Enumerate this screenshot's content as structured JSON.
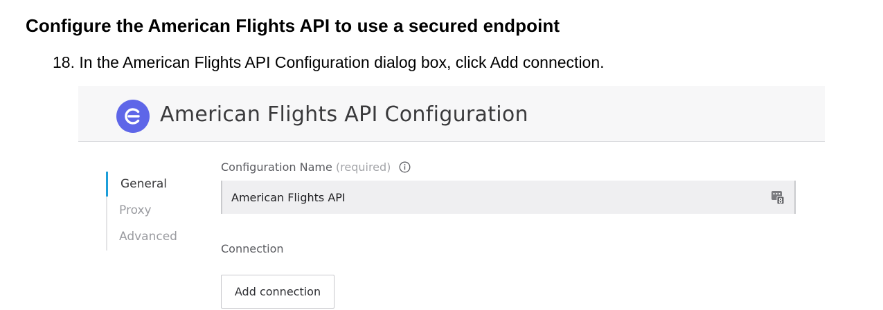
{
  "document": {
    "heading": "Configure the American Flights API to use a secured endpoint",
    "step": "18. In the American Flights API Configuration dialog box, click Add connection."
  },
  "dialog": {
    "title": "American Flights API Configuration",
    "nav": {
      "items": [
        {
          "label": "General",
          "active": true
        },
        {
          "label": "Proxy",
          "active": false
        },
        {
          "label": "Advanced",
          "active": false
        }
      ]
    },
    "config_name": {
      "label": "Configuration Name",
      "required": "(required)",
      "value": "American Flights API"
    },
    "connection": {
      "label": "Connection",
      "button": "Add connection"
    }
  },
  "icons": {
    "logo": "connector-logo-icon",
    "info": "info-icon",
    "expression": "expression-icon"
  },
  "colors": {
    "accent": "#1c9ed9",
    "logo": "#5e66e8"
  }
}
